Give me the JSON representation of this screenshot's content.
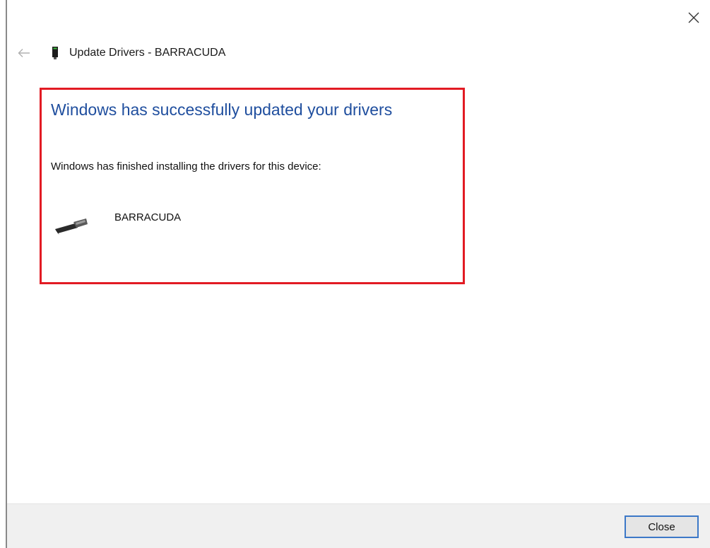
{
  "window": {
    "close_icon": "close-icon"
  },
  "header": {
    "back_icon": "back-arrow-icon",
    "device_icon": "usb-device-icon",
    "title": "Update Drivers - BARRACUDA"
  },
  "content": {
    "heading": "Windows has successfully updated your drivers",
    "message": "Windows has finished installing the drivers for this device:",
    "device": {
      "icon": "usb-connector-icon",
      "name": "BARRACUDA"
    },
    "highlight_color": "#e21b23",
    "heading_color": "#1f4e9e"
  },
  "footer": {
    "close_label": "Close"
  }
}
